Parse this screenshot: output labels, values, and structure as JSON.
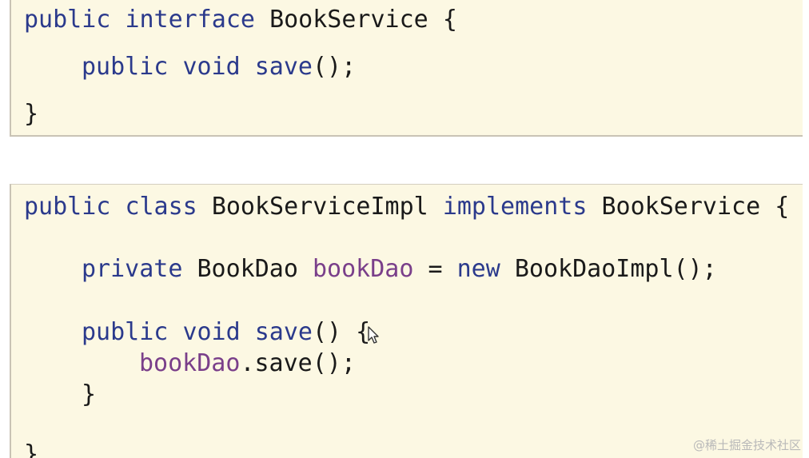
{
  "block1": {
    "line1": {
      "kw1": "public",
      "kw2": "interface",
      "name": "BookService",
      "brace": "{"
    },
    "line2": {
      "kw1": "public",
      "kw2": "void",
      "method": "save",
      "rest": "();"
    },
    "line3": {
      "brace": "}"
    }
  },
  "block2": {
    "line1": {
      "kw1": "public",
      "kw2": "class",
      "name": "BookServiceImpl",
      "kw3": "implements",
      "iface": "BookService",
      "brace": "{"
    },
    "line2": {
      "kw1": "private",
      "type": "BookDao",
      "field": "bookDao",
      "eq": "=",
      "kw2": "new",
      "ctor": "BookDaoImpl();"
    },
    "line3": {
      "kw1": "public",
      "kw2": "void",
      "method": "save",
      "rest": "() {"
    },
    "line4": {
      "field": "bookDao",
      "rest": ".save();"
    },
    "line5": {
      "brace": "}"
    },
    "line6": {
      "brace": "}"
    }
  },
  "icons": {
    "cursor": "mouse-pointer-icon"
  },
  "colors": {
    "keyword": "#2b3a8c",
    "field": "#7a3f8a",
    "background": "#fcf8e3"
  },
  "watermark": "@稀土掘金技术社区"
}
